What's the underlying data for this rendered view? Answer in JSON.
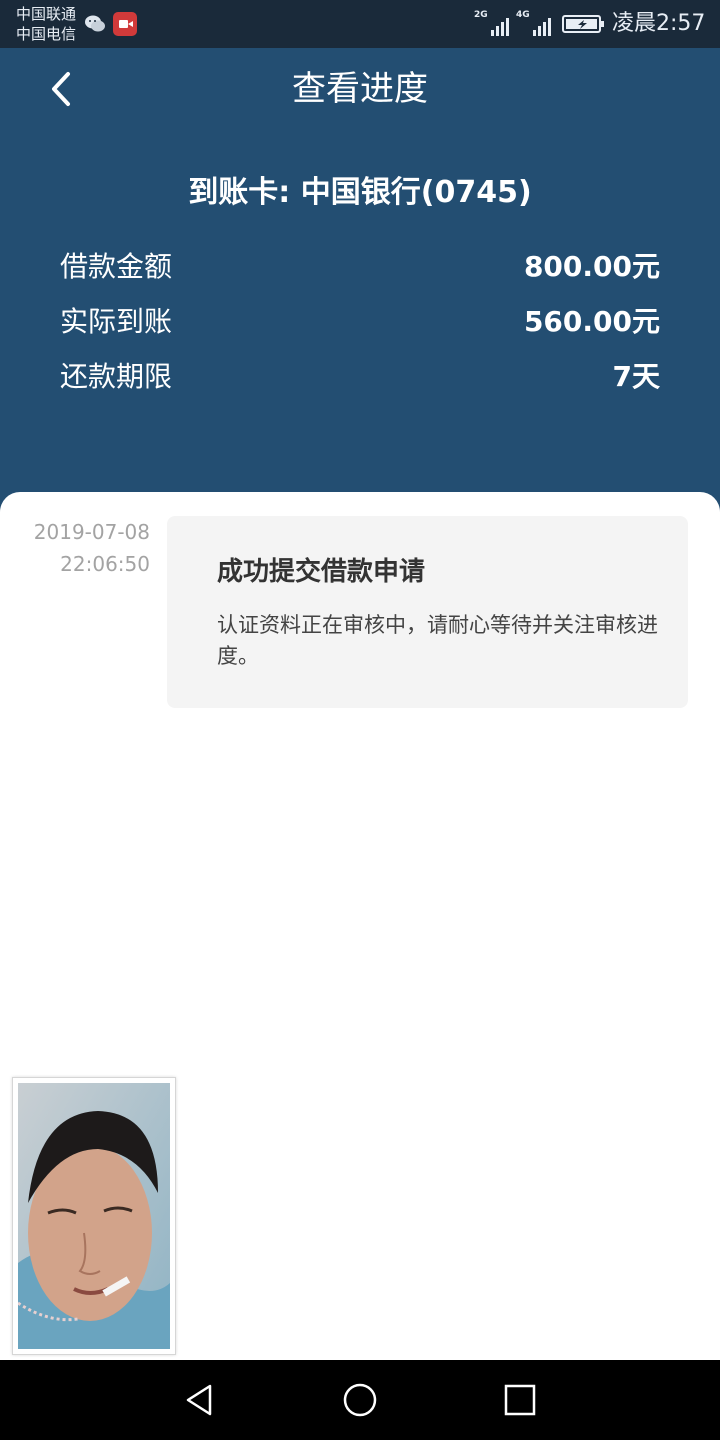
{
  "status_bar": {
    "carrier_1": "中国联通",
    "carrier_2": "中国电信",
    "network_1": "2G",
    "network_2": "4G",
    "clock": "凌晨2:57"
  },
  "header": {
    "title": "查看进度",
    "card_line": "到账卡:  中国银行(0745)",
    "rows": [
      {
        "label": "借款金额",
        "value": "800.00元"
      },
      {
        "label": "实际到账",
        "value": "560.00元"
      },
      {
        "label": "还款期限",
        "value": "7天"
      }
    ]
  },
  "progress": {
    "date": "2019-07-08",
    "time": "22:06:50",
    "title": "成功提交借款申请",
    "description": "认证资料正在审核中，请耐心等待并关注审核进度。"
  },
  "icons": {
    "back": "chevron-left-icon",
    "wechat": "wechat-icon",
    "camera": "video-camera-icon",
    "battery": "battery-charging-icon",
    "nav_back": "triangle-back-icon",
    "nav_home": "circle-home-icon",
    "nav_recent": "square-recent-icon"
  },
  "colors": {
    "header_bg": "#234e72",
    "status_bg": "#1a2a3a",
    "card_bg": "#f4f4f4",
    "timestamp": "#a3a3a3"
  }
}
